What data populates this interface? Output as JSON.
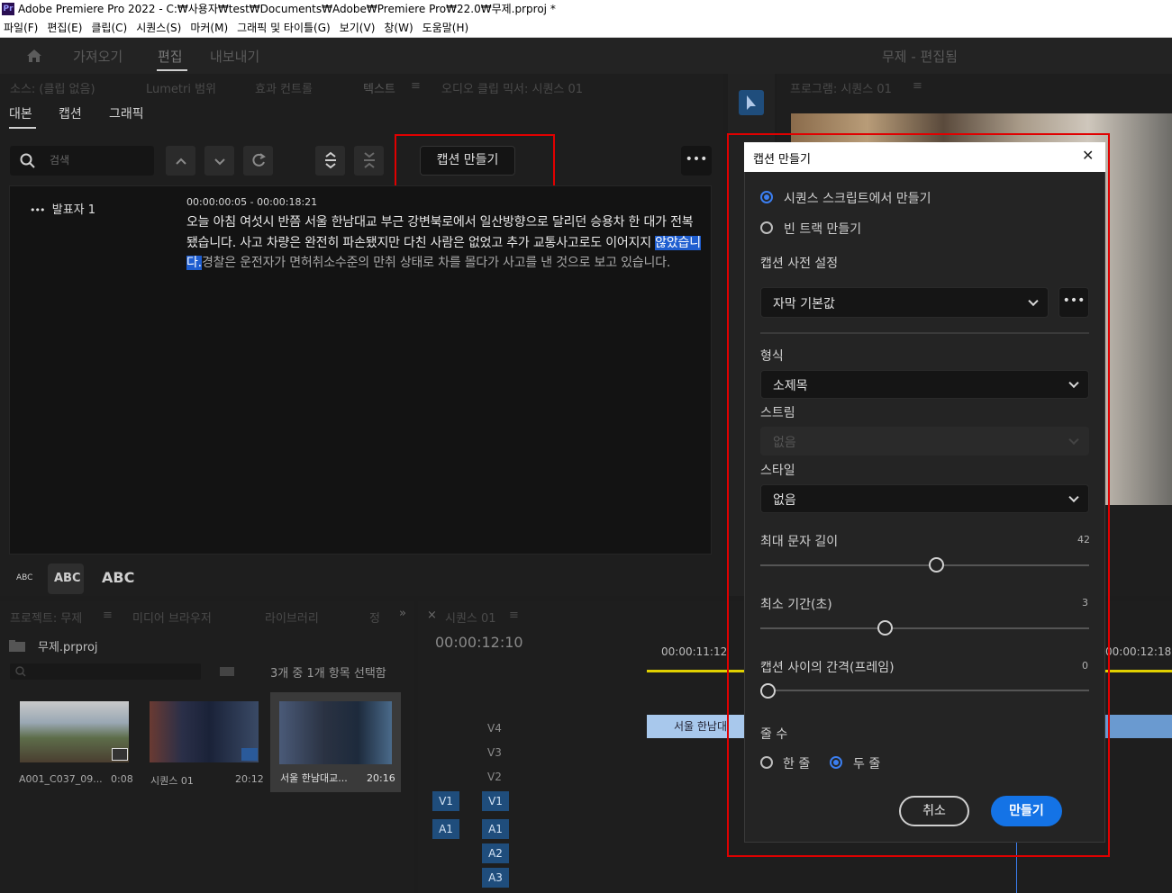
{
  "window": {
    "app_icon": "Pr",
    "title": "Adobe Premiere Pro 2022 - C:₩사용자₩test₩Documents₩Adobe₩Premiere Pro₩22.0₩무제.prproj *"
  },
  "menu": [
    "파일(F)",
    "편집(E)",
    "클립(C)",
    "시퀀스(S)",
    "마커(M)",
    "그래픽 및 타이틀(G)",
    "보기(V)",
    "창(W)",
    "도움말(H)"
  ],
  "workspace": {
    "import": "가져오기",
    "edit": "편집",
    "export": "내보내기",
    "project_name": "무제 - 편집됨"
  },
  "panel_tabs": {
    "source": "소스: (클립 없음)",
    "lumetri": "Lumetri 범위",
    "effects": "효과 컨트롤",
    "text": "텍스트",
    "audio_mixer": "오디오 클립 믹서: 시퀀스 01",
    "program": "프로그램: 시퀀스 01"
  },
  "text_panel": {
    "subtabs": [
      "대본",
      "캡션",
      "그래픽"
    ],
    "search_placeholder": "검색",
    "create_captions": "캡션 만들기",
    "speaker": "발표자 1",
    "timecode": "00:00:00:05 - 00:00:18:21",
    "transcript_before": "오늘 아침 여섯시 반쯤 서울 한남대교 부근 강변북로에서 일산방향으로 달리던 승용차 한 대가 전복됐습니다. 사고 차량은 완전히 파손됐지만 다친 사람은 없었고 추가 교통사고로도 이어지지 ",
    "transcript_highlight": "않았습니다.",
    "transcript_after": "경찰은 운전자가 면허취소수준의 만취 상태로 차를 몰다가 사고를 낸 것으로 보고 있습니다.",
    "font_size_labels": [
      "ABC",
      "ABC",
      "ABC"
    ]
  },
  "project": {
    "tabs": [
      "프로젝트: 무제",
      "미디어 브라우저",
      "라이브러리",
      "정"
    ],
    "file": "무제.prproj",
    "selection": "3개 중 1개 항목 선택함",
    "items": [
      {
        "name": "A001_C037_09...",
        "dur": "0:08"
      },
      {
        "name": "시퀀스 01",
        "dur": "20:12"
      },
      {
        "name": "서울 한남대교...",
        "dur": "20:16"
      }
    ]
  },
  "timeline": {
    "tab": "시퀀스 01",
    "timecode": "00:00:12:10",
    "ruler": [
      "00:00:11:12",
      "00:00:12:18"
    ],
    "video_tracks": [
      "V4",
      "V3",
      "V2",
      "V1"
    ],
    "audio_tracks": [
      "A1",
      "A2",
      "A3"
    ],
    "source_v": "V1",
    "source_a": "A1",
    "clip_label": "서울 한남대"
  },
  "dialog": {
    "title": "캡션 만들기",
    "option_from_script": "시퀀스 스크립트에서 만들기",
    "option_empty_track": "빈 트랙 만들기",
    "preset_label": "캡션 사전 설정",
    "preset_value": "자막 기본값",
    "format_label": "형식",
    "format_value": "소제목",
    "stream_label": "스트림",
    "stream_value": "없음",
    "style_label": "스타일",
    "style_value": "없음",
    "max_chars_label": "최대 문자 길이",
    "max_chars_value": "42",
    "min_duration_label": "최소 기간(초)",
    "min_duration_value": "3",
    "gap_label": "캡션 사이의 간격(프레임)",
    "gap_value": "0",
    "lines_label": "줄 수",
    "lines_single": "한 줄",
    "lines_double": "두 줄",
    "cancel": "취소",
    "create": "만들기"
  },
  "colors": {
    "accent": "#1473e6",
    "highlight": "#e00000",
    "selection": "#1f5ed0"
  }
}
